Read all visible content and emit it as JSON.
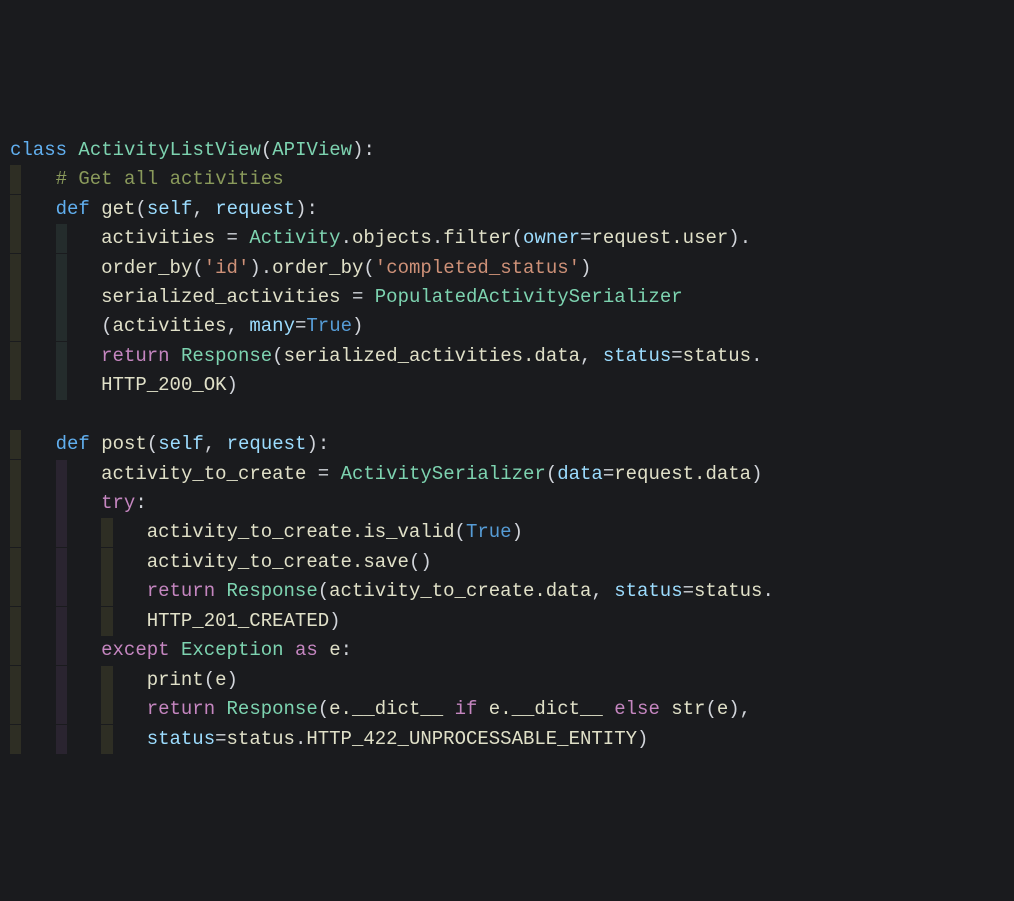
{
  "code": {
    "lines": [
      [
        {
          "cls": "kw",
          "text": "class"
        },
        {
          "cls": "sp",
          "text": " "
        },
        {
          "cls": "cls",
          "text": "ActivityListView"
        },
        {
          "cls": "punc",
          "text": "("
        },
        {
          "cls": "cls",
          "text": "APIView"
        },
        {
          "cls": "punc",
          "text": "):"
        }
      ],
      [
        {
          "cls": "cmt",
          "text": "# Get all activities"
        }
      ],
      [
        {
          "cls": "kw",
          "text": "def"
        },
        {
          "cls": "sp",
          "text": " "
        },
        {
          "cls": "fn",
          "text": "get"
        },
        {
          "cls": "punc",
          "text": "("
        },
        {
          "cls": "param",
          "text": "self"
        },
        {
          "cls": "punc",
          "text": ", "
        },
        {
          "cls": "param",
          "text": "request"
        },
        {
          "cls": "punc",
          "text": "):"
        }
      ],
      [
        {
          "cls": "prop",
          "text": "activities "
        },
        {
          "cls": "op",
          "text": "= "
        },
        {
          "cls": "cls",
          "text": "Activity"
        },
        {
          "cls": "punc",
          "text": "."
        },
        {
          "cls": "prop",
          "text": "objects"
        },
        {
          "cls": "punc",
          "text": "."
        },
        {
          "cls": "call",
          "text": "filter"
        },
        {
          "cls": "punc",
          "text": "("
        },
        {
          "cls": "param",
          "text": "owner"
        },
        {
          "cls": "op",
          "text": "="
        },
        {
          "cls": "prop",
          "text": "request.user"
        },
        {
          "cls": "punc",
          "text": ")."
        }
      ],
      [
        {
          "cls": "call",
          "text": "order_by"
        },
        {
          "cls": "punc",
          "text": "("
        },
        {
          "cls": "str",
          "text": "'id'"
        },
        {
          "cls": "punc",
          "text": ")."
        },
        {
          "cls": "call",
          "text": "order_by"
        },
        {
          "cls": "punc",
          "text": "("
        },
        {
          "cls": "str",
          "text": "'completed_status'"
        },
        {
          "cls": "punc",
          "text": ")"
        }
      ],
      [
        {
          "cls": "prop",
          "text": "serialized_activities "
        },
        {
          "cls": "op",
          "text": "= "
        },
        {
          "cls": "cls",
          "text": "PopulatedActivitySerializer"
        }
      ],
      [
        {
          "cls": "punc",
          "text": "("
        },
        {
          "cls": "prop",
          "text": "activities"
        },
        {
          "cls": "punc",
          "text": ", "
        },
        {
          "cls": "param",
          "text": "many"
        },
        {
          "cls": "op",
          "text": "="
        },
        {
          "cls": "const",
          "text": "True"
        },
        {
          "cls": "punc",
          "text": ")"
        }
      ],
      [
        {
          "cls": "ret",
          "text": "return"
        },
        {
          "cls": "sp",
          "text": " "
        },
        {
          "cls": "cls",
          "text": "Response"
        },
        {
          "cls": "punc",
          "text": "("
        },
        {
          "cls": "prop",
          "text": "serialized_activities.data"
        },
        {
          "cls": "punc",
          "text": ", "
        },
        {
          "cls": "param",
          "text": "status"
        },
        {
          "cls": "op",
          "text": "="
        },
        {
          "cls": "prop",
          "text": "status"
        },
        {
          "cls": "punc",
          "text": "."
        }
      ],
      [
        {
          "cls": "prop",
          "text": "HTTP_200_OK"
        },
        {
          "cls": "punc",
          "text": ")"
        }
      ],
      [],
      [
        {
          "cls": "kw",
          "text": "def"
        },
        {
          "cls": "sp",
          "text": " "
        },
        {
          "cls": "fn",
          "text": "post"
        },
        {
          "cls": "punc",
          "text": "("
        },
        {
          "cls": "param",
          "text": "self"
        },
        {
          "cls": "punc",
          "text": ", "
        },
        {
          "cls": "param",
          "text": "request"
        },
        {
          "cls": "punc",
          "text": "):"
        }
      ],
      [
        {
          "cls": "prop",
          "text": "activity_to_create "
        },
        {
          "cls": "op",
          "text": "= "
        },
        {
          "cls": "cls",
          "text": "ActivitySerializer"
        },
        {
          "cls": "punc",
          "text": "("
        },
        {
          "cls": "param",
          "text": "data"
        },
        {
          "cls": "op",
          "text": "="
        },
        {
          "cls": "prop",
          "text": "request.data"
        },
        {
          "cls": "punc",
          "text": ")"
        }
      ],
      [
        {
          "cls": "ret",
          "text": "try"
        },
        {
          "cls": "punc",
          "text": ":"
        }
      ],
      [
        {
          "cls": "prop",
          "text": "activity_to_create."
        },
        {
          "cls": "call",
          "text": "is_valid"
        },
        {
          "cls": "punc",
          "text": "("
        },
        {
          "cls": "const",
          "text": "True"
        },
        {
          "cls": "punc",
          "text": ")"
        }
      ],
      [
        {
          "cls": "prop",
          "text": "activity_to_create."
        },
        {
          "cls": "call",
          "text": "save"
        },
        {
          "cls": "punc",
          "text": "()"
        }
      ],
      [
        {
          "cls": "ret",
          "text": "return"
        },
        {
          "cls": "sp",
          "text": " "
        },
        {
          "cls": "cls",
          "text": "Response"
        },
        {
          "cls": "punc",
          "text": "("
        },
        {
          "cls": "prop",
          "text": "activity_to_create.data"
        },
        {
          "cls": "punc",
          "text": ", "
        },
        {
          "cls": "param",
          "text": "status"
        },
        {
          "cls": "op",
          "text": "="
        },
        {
          "cls": "prop",
          "text": "status"
        },
        {
          "cls": "punc",
          "text": "."
        }
      ],
      [
        {
          "cls": "prop",
          "text": "HTTP_201_CREATED"
        },
        {
          "cls": "punc",
          "text": ")"
        }
      ],
      [
        {
          "cls": "ret",
          "text": "except"
        },
        {
          "cls": "sp",
          "text": " "
        },
        {
          "cls": "cls",
          "text": "Exception"
        },
        {
          "cls": "sp",
          "text": " "
        },
        {
          "cls": "ret",
          "text": "as"
        },
        {
          "cls": "sp",
          "text": " "
        },
        {
          "cls": "prop",
          "text": "e"
        },
        {
          "cls": "punc",
          "text": ":"
        }
      ],
      [
        {
          "cls": "call",
          "text": "print"
        },
        {
          "cls": "punc",
          "text": "("
        },
        {
          "cls": "prop",
          "text": "e"
        },
        {
          "cls": "punc",
          "text": ")"
        }
      ],
      [
        {
          "cls": "ret",
          "text": "return"
        },
        {
          "cls": "sp",
          "text": " "
        },
        {
          "cls": "cls",
          "text": "Response"
        },
        {
          "cls": "punc",
          "text": "("
        },
        {
          "cls": "prop",
          "text": "e.__dict__"
        },
        {
          "cls": "sp",
          "text": " "
        },
        {
          "cls": "ret",
          "text": "if"
        },
        {
          "cls": "sp",
          "text": " "
        },
        {
          "cls": "prop",
          "text": "e.__dict__"
        },
        {
          "cls": "sp",
          "text": " "
        },
        {
          "cls": "ret",
          "text": "else"
        },
        {
          "cls": "sp",
          "text": " "
        },
        {
          "cls": "call",
          "text": "str"
        },
        {
          "cls": "punc",
          "text": "("
        },
        {
          "cls": "prop",
          "text": "e"
        },
        {
          "cls": "punc",
          "text": "),"
        }
      ],
      [
        {
          "cls": "param",
          "text": "status"
        },
        {
          "cls": "op",
          "text": "="
        },
        {
          "cls": "prop",
          "text": "status"
        },
        {
          "cls": "punc",
          "text": "."
        },
        {
          "cls": "prop",
          "text": "HTTP_422_UNPROCESSABLE_ENTITY"
        },
        {
          "cls": "punc",
          "text": ")"
        }
      ]
    ],
    "indents": [
      {
        "level": 0,
        "guides": []
      },
      {
        "level": 1,
        "guides": [
          "ga"
        ]
      },
      {
        "level": 1,
        "guides": [
          "ga"
        ]
      },
      {
        "level": 2,
        "guides": [
          "ga",
          "gb"
        ]
      },
      {
        "level": 2,
        "guides": [
          "ga",
          "gb"
        ]
      },
      {
        "level": 2,
        "guides": [
          "ga",
          "gb"
        ]
      },
      {
        "level": 2,
        "guides": [
          "ga",
          "gb"
        ]
      },
      {
        "level": 2,
        "guides": [
          "ga",
          "gb"
        ]
      },
      {
        "level": 2,
        "guides": [
          "ga",
          "gb"
        ]
      },
      {
        "level": 0,
        "guides": []
      },
      {
        "level": 1,
        "guides": [
          "ga"
        ]
      },
      {
        "level": 2,
        "guides": [
          "ga",
          "gc"
        ]
      },
      {
        "level": 2,
        "guides": [
          "ga",
          "gc"
        ]
      },
      {
        "level": 3,
        "guides": [
          "ga",
          "gc",
          "ga"
        ]
      },
      {
        "level": 3,
        "guides": [
          "ga",
          "gc",
          "ga"
        ]
      },
      {
        "level": 3,
        "guides": [
          "ga",
          "gc",
          "ga"
        ]
      },
      {
        "level": 3,
        "guides": [
          "ga",
          "gc",
          "ga"
        ]
      },
      {
        "level": 2,
        "guides": [
          "ga",
          "gc"
        ]
      },
      {
        "level": 3,
        "guides": [
          "ga",
          "gc",
          "ga"
        ]
      },
      {
        "level": 3,
        "guides": [
          "ga",
          "gc",
          "ga"
        ]
      },
      {
        "level": 3,
        "guides": [
          "ga",
          "gc",
          "ga"
        ]
      }
    ]
  }
}
